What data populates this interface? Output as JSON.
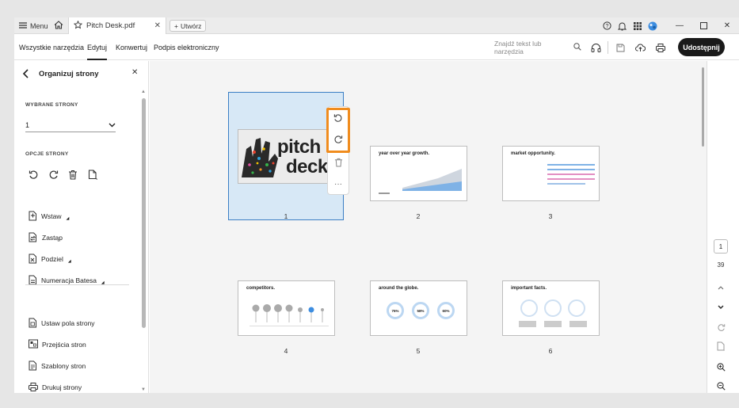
{
  "titlebar": {
    "menu_label": "Menu",
    "doc_tab_title": "Pitch Desk.pdf",
    "new_tab_label": "Utwórz"
  },
  "toolbar": {
    "tabs": [
      {
        "label": "Wszystkie narzędzia"
      },
      {
        "label": "Edytuj"
      },
      {
        "label": "Konwertuj"
      },
      {
        "label": "Podpis elektroniczny"
      }
    ],
    "search_placeholder": "Znajdź tekst lub narzędzia",
    "share_label": "Udostępnij"
  },
  "panel": {
    "title": "Organizuj strony",
    "selected_pages_label": "WYBRANE STRONY",
    "selected_pages_value": "1",
    "page_options_label": "OPCJE STRONY",
    "items": [
      {
        "label": "Wstaw"
      },
      {
        "label": "Zastąp"
      },
      {
        "label": "Podziel"
      },
      {
        "label": "Numeracja Batesa"
      },
      {
        "label": "Ustaw pola strony"
      },
      {
        "label": "Przejścia stron"
      },
      {
        "label": "Szablony stron"
      },
      {
        "label": "Drukuj strony"
      }
    ]
  },
  "pages": [
    {
      "number": "1",
      "text1": "pitch",
      "text2": "deck"
    },
    {
      "number": "2",
      "title": "year over year growth."
    },
    {
      "number": "3",
      "title": "market opportunity."
    },
    {
      "number": "4",
      "title": "competitors."
    },
    {
      "number": "5",
      "title": "around the globe.",
      "stats": [
        "76%",
        "58%",
        "60%"
      ]
    },
    {
      "number": "6",
      "title": "important facts."
    }
  ],
  "rail": {
    "current_page": "1",
    "total_pages": "39"
  },
  "colors": {
    "selection_fill": "#d7e8f6",
    "selection_border": "#3c7fc4",
    "rotate_highlight": "#f08c1e",
    "share_button": "#1a1a1a"
  }
}
